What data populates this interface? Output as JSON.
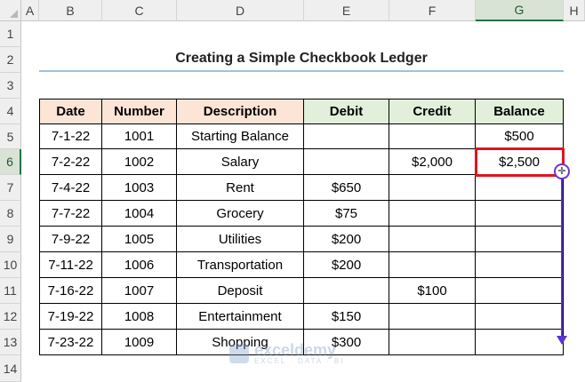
{
  "columns": [
    "A",
    "B",
    "C",
    "D",
    "E",
    "F",
    "G",
    "H"
  ],
  "rows": [
    "1",
    "2",
    "3",
    "4",
    "5",
    "6",
    "7",
    "8",
    "9",
    "10",
    "11",
    "12",
    "13",
    "14"
  ],
  "title": "Creating a Simple Checkbook Ledger",
  "table": {
    "headers": [
      "Date",
      "Number",
      "Description",
      "Debit",
      "Credit",
      "Balance"
    ],
    "rows": [
      [
        "7-1-22",
        "1001",
        "Starting Balance",
        "",
        "",
        "$500"
      ],
      [
        "7-2-22",
        "1002",
        "Salary",
        "",
        "$2,000",
        "$2,500"
      ],
      [
        "7-4-22",
        "1003",
        "Rent",
        "$650",
        "",
        ""
      ],
      [
        "7-7-22",
        "1004",
        "Grocery",
        "$75",
        "",
        ""
      ],
      [
        "7-9-22",
        "1005",
        "Utilities",
        "$200",
        "",
        ""
      ],
      [
        "7-11-22",
        "1006",
        "Transportation",
        "$200",
        "",
        ""
      ],
      [
        "7-16-22",
        "1007",
        "Deposit",
        "",
        "$100",
        ""
      ],
      [
        "7-19-22",
        "1008",
        "Entertainment",
        "$150",
        "",
        ""
      ],
      [
        "7-23-22",
        "1009",
        "Shopping",
        "$300",
        "",
        ""
      ]
    ]
  },
  "selected_cell": "G6",
  "watermark": {
    "name": "exceldemy",
    "sub": "EXCEL · DATA · BI"
  },
  "colors": {
    "header_peach": "#fce4d6",
    "header_green": "#e2efda",
    "selection_red": "#e0141e",
    "drag_purple": "#5a35d0"
  }
}
